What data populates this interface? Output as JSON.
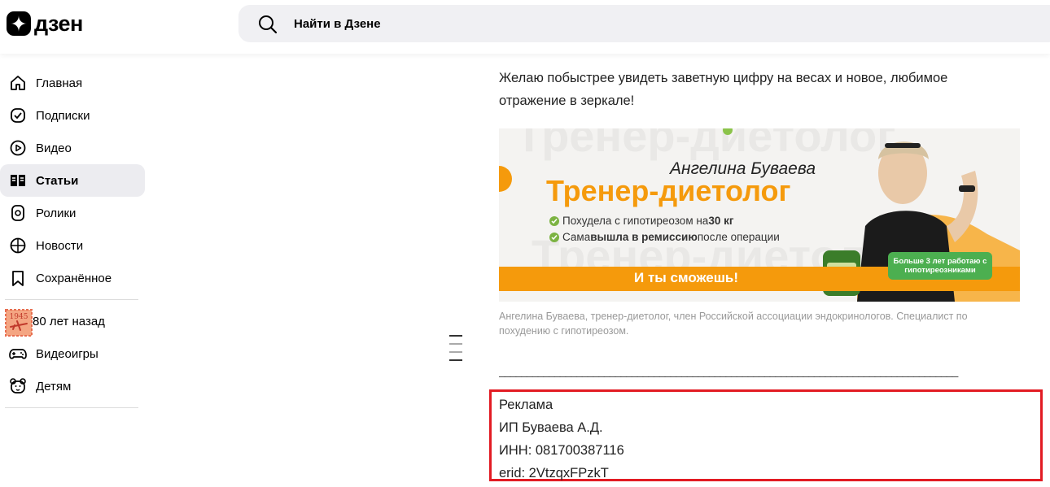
{
  "header": {
    "logo_text": "дзен",
    "search_placeholder": "Найти в Дзене"
  },
  "sidebar": {
    "items": [
      {
        "label": "Главная",
        "icon": "home-icon"
      },
      {
        "label": "Подписки",
        "icon": "subscriptions-icon"
      },
      {
        "label": "Видео",
        "icon": "video-icon"
      },
      {
        "label": "Статьи",
        "icon": "articles-icon",
        "active": true
      },
      {
        "label": "Ролики",
        "icon": "shorts-icon"
      },
      {
        "label": "Новости",
        "icon": "news-icon"
      },
      {
        "label": "Сохранённое",
        "icon": "bookmark-icon"
      }
    ],
    "extra_items": [
      {
        "label": "80 лет назад",
        "icon": "stamp-1945-icon",
        "stamp_text": "1945"
      },
      {
        "label": "Видеоигры",
        "icon": "gamepad-icon"
      },
      {
        "label": "Детям",
        "icon": "bear-icon"
      }
    ]
  },
  "article": {
    "paragraph": "Желаю побыстрее увидеть заветную цифру на весах и новое, любимое отражение в зеркале!",
    "banner": {
      "name": "Ангелина Буваева",
      "title": "Тренер-диетолог",
      "bullet_1_pre": "Похудела с гипотиреозом на ",
      "bullet_1_bold": "30 кг",
      "bullet_2_pre": "Сама ",
      "bullet_2_bold": "вышла в ремиссию",
      "bullet_2_post": " после операции",
      "cta": "И ты сможешь!",
      "badge": "Больше 3 лет работаю с гипотиреозниками"
    },
    "caption": "Ангелина Буваева, тренер-диетолог, член Российской ассоциации эндокринологов. Специалист по похудению с гипотиреозом.",
    "rule": "___________________________________________________________________________________",
    "ad": {
      "label": "Реклама",
      "advertiser": "ИП Буваева А.Д.",
      "inn": "ИНН: 081700387116",
      "erid": "erid: 2VtzqxFPzkT"
    }
  },
  "colors": {
    "accent_orange": "#f59a0c",
    "highlight_red": "#e21b23",
    "active_bg": "#ececf0"
  }
}
